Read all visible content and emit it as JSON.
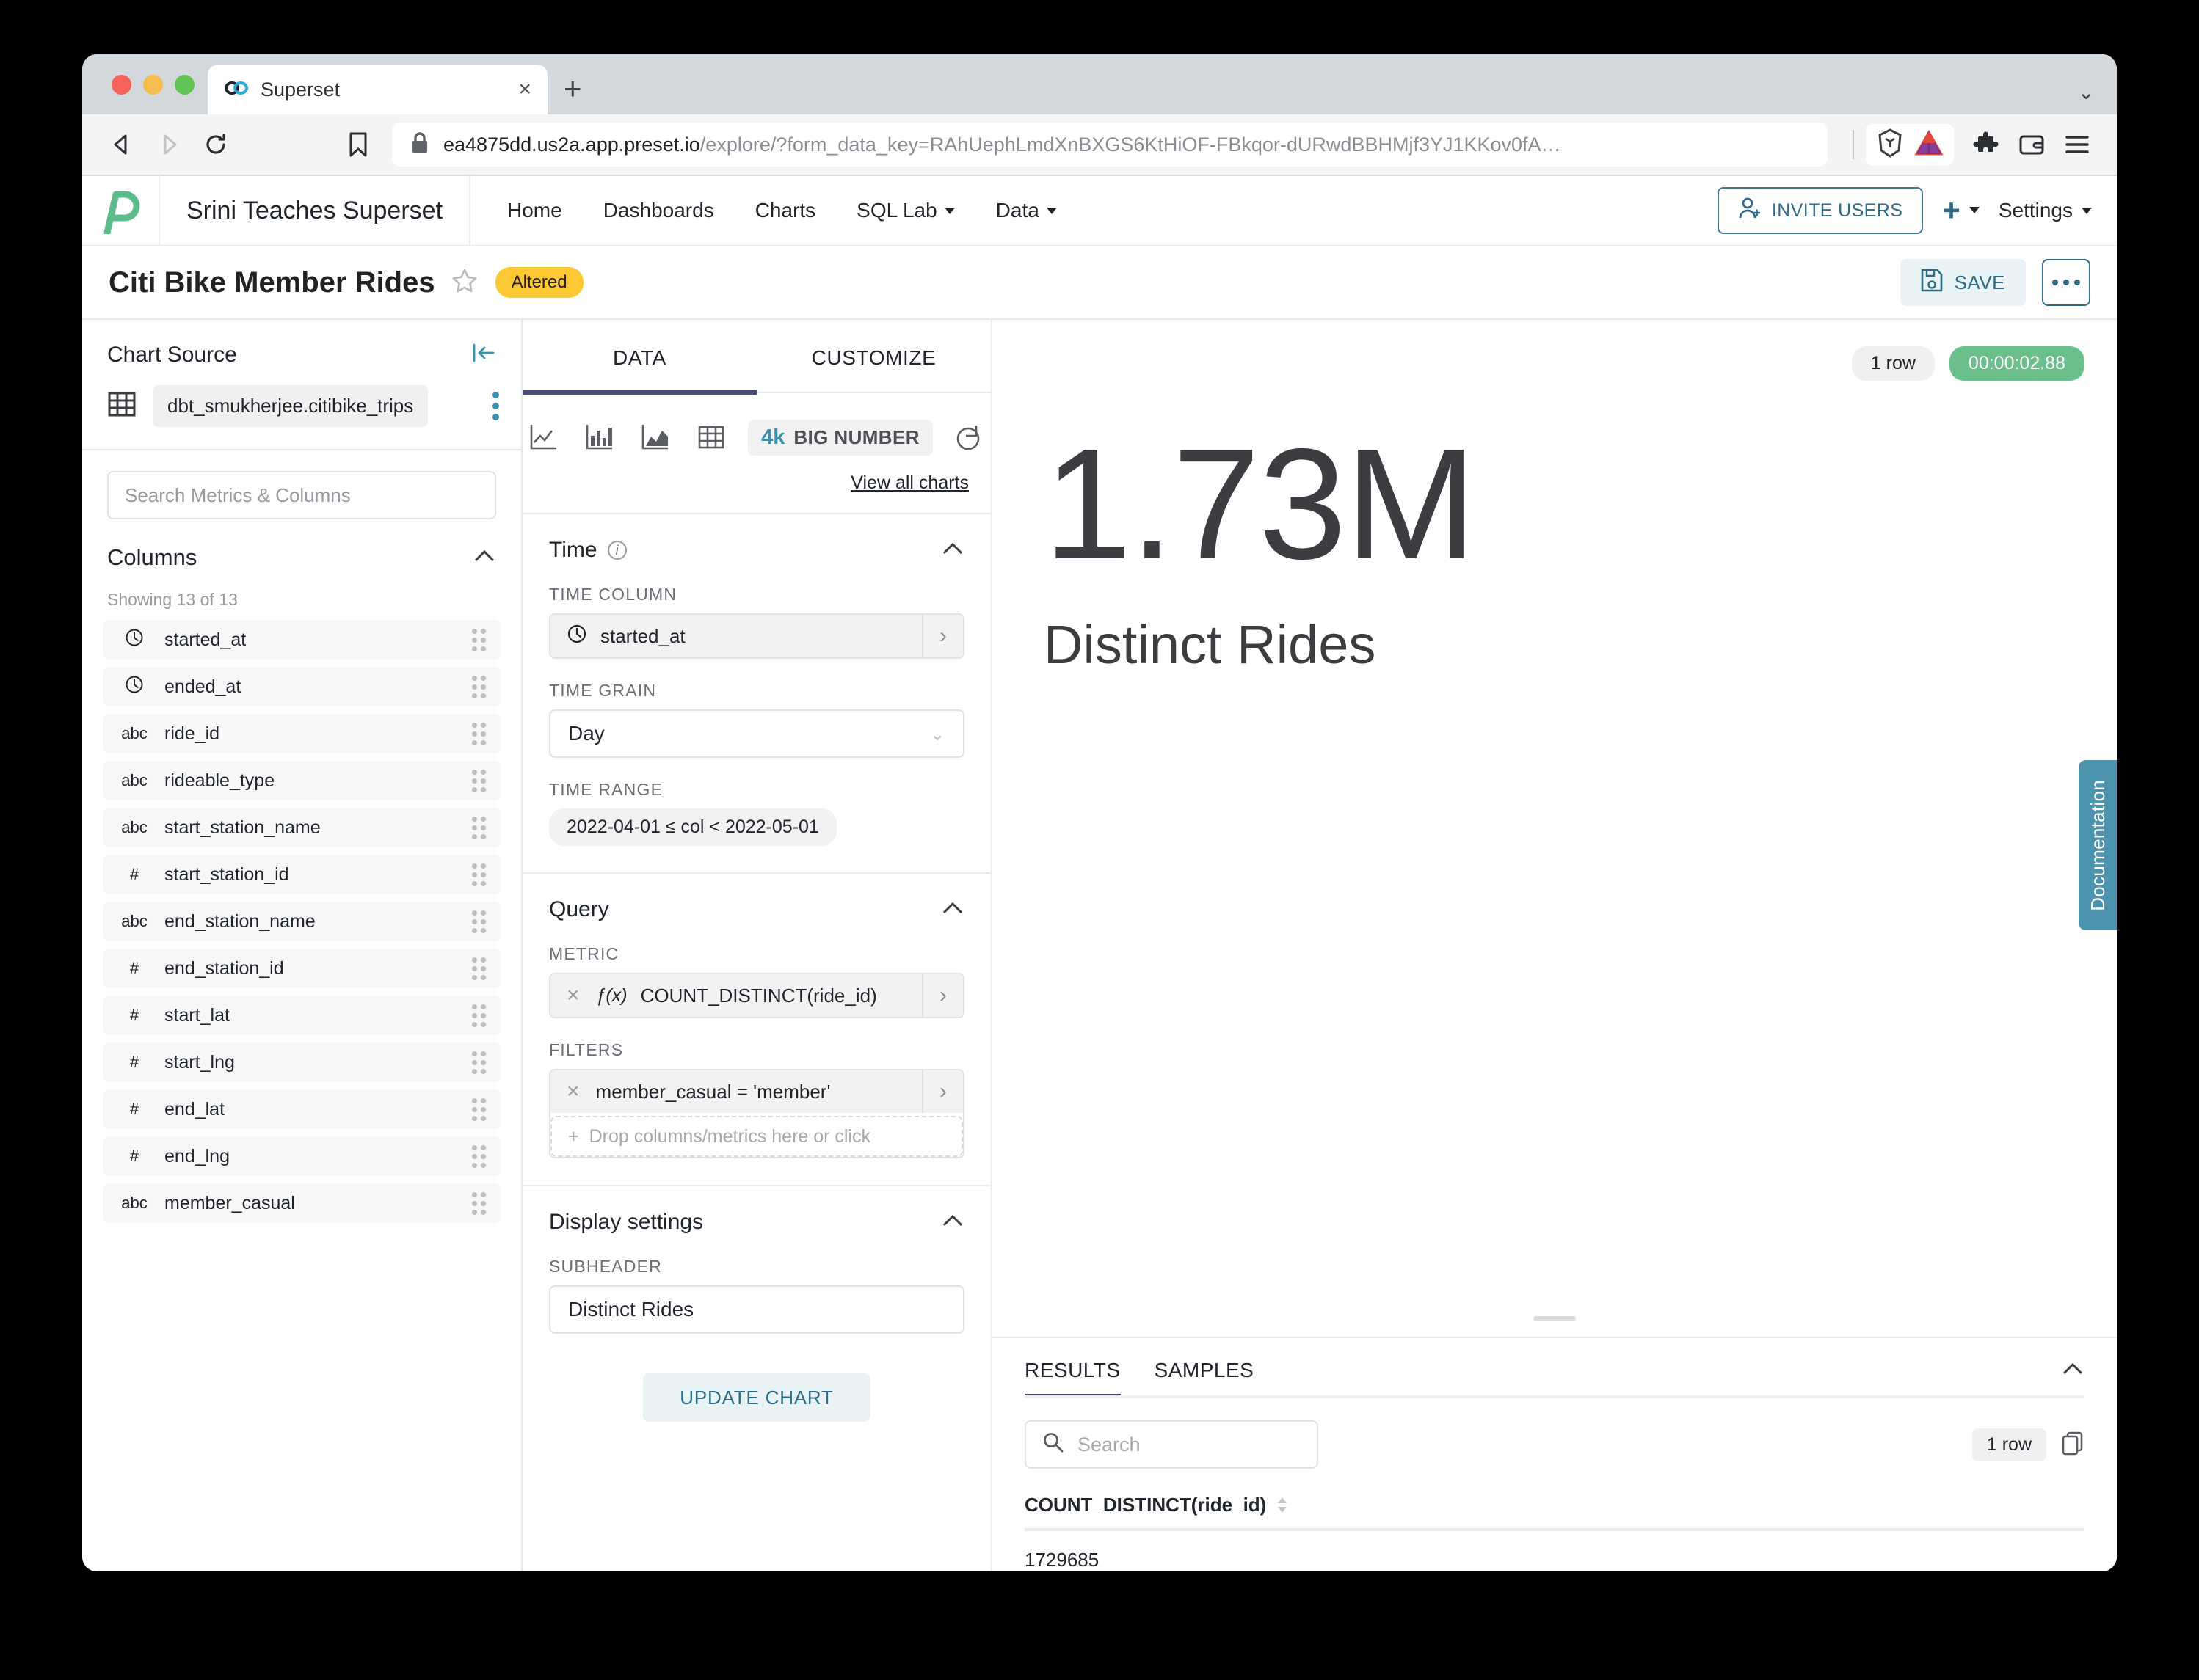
{
  "browser": {
    "tab": {
      "title": "Superset",
      "favicon": "superset-icon",
      "close_label": "×"
    },
    "new_tab_label": "+",
    "tabstrip_chevron": "⌄",
    "url_domain": "ea4875dd.us2a.app.preset.io",
    "url_path": "/explore/?form_data_key=RAhUephLmdXnBXGS6KtHiOF-FBkqor-dURwdBBHMjf3YJ1KKov0fA…",
    "back_label": "◁",
    "forward_label": "▷",
    "reload_label": "↻",
    "bookmark_label": "☐"
  },
  "nav": {
    "brand": "Srini Teaches Superset",
    "items": [
      {
        "label": "Home",
        "has_caret": false
      },
      {
        "label": "Dashboards",
        "has_caret": false
      },
      {
        "label": "Charts",
        "has_caret": false
      },
      {
        "label": "SQL Lab",
        "has_caret": true
      },
      {
        "label": "Data",
        "has_caret": true
      }
    ],
    "invite_users": "INVITE USERS",
    "settings": "Settings"
  },
  "chart_header": {
    "title": "Citi Bike Member Rides",
    "badge": "Altered",
    "save": "SAVE"
  },
  "left_pane": {
    "title": "Chart Source",
    "dataset": "dbt_smukherjee.citibike_trips",
    "search_placeholder": "Search Metrics & Columns",
    "columns_title": "Columns",
    "showing": "Showing 13 of 13",
    "columns": [
      {
        "type": "clock",
        "name": "started_at"
      },
      {
        "type": "clock",
        "name": "ended_at"
      },
      {
        "type": "abc",
        "name": "ride_id"
      },
      {
        "type": "abc",
        "name": "rideable_type"
      },
      {
        "type": "abc",
        "name": "start_station_name"
      },
      {
        "type": "#",
        "name": "start_station_id"
      },
      {
        "type": "abc",
        "name": "end_station_name"
      },
      {
        "type": "#",
        "name": "end_station_id"
      },
      {
        "type": "#",
        "name": "start_lat"
      },
      {
        "type": "#",
        "name": "start_lng"
      },
      {
        "type": "#",
        "name": "end_lat"
      },
      {
        "type": "#",
        "name": "end_lng"
      },
      {
        "type": "abc",
        "name": "member_casual"
      }
    ]
  },
  "mid_pane": {
    "tabs": [
      {
        "label": "DATA",
        "active": true
      },
      {
        "label": "CUSTOMIZE",
        "active": false
      }
    ],
    "viz_4k": "4k",
    "viz_bignumber": "BIG NUMBER",
    "view_all_charts": "View all charts",
    "time_section": {
      "title": "Time",
      "time_column_label": "TIME COLUMN",
      "time_column_value": "started_at",
      "time_grain_label": "TIME GRAIN",
      "time_grain_value": "Day",
      "time_range_label": "TIME RANGE",
      "time_range_value": "2022-04-01 ≤ col < 2022-05-01"
    },
    "query_section": {
      "title": "Query",
      "metric_label": "METRIC",
      "metric_value": "COUNT_DISTINCT(ride_id)",
      "metric_fx": "ƒ(x)",
      "filters_label": "FILTERS",
      "filter_value": "member_casual = 'member'",
      "filter_dropzone": "Drop columns/metrics here or click"
    },
    "display_section": {
      "title": "Display settings",
      "subheader_label": "SUBHEADER",
      "subheader_value": "Distinct Rides"
    },
    "update_chart": "UPDATE CHART"
  },
  "right_pane": {
    "rows_badge": "1 row",
    "time_badge": "00:00:02.88",
    "big_number": "1.73M",
    "subheader": "Distinct Rides",
    "results": {
      "tabs": [
        {
          "label": "RESULTS",
          "active": true
        },
        {
          "label": "SAMPLES",
          "active": false
        }
      ],
      "search_placeholder": "Search",
      "rows_badge": "1 row",
      "columns": [
        "COUNT_DISTINCT(ride_id)"
      ],
      "rows": [
        [
          "1729685"
        ]
      ]
    },
    "documentation_tab": "Documentation"
  },
  "colors": {
    "accent_teal": "#2f6b86",
    "brand_green": "#5dbd8a",
    "badge_yellow": "#fcc934",
    "timer_green": "#6bbf8a",
    "tab_indigo": "#484c7a",
    "doc_blue": "#4c93ad"
  }
}
